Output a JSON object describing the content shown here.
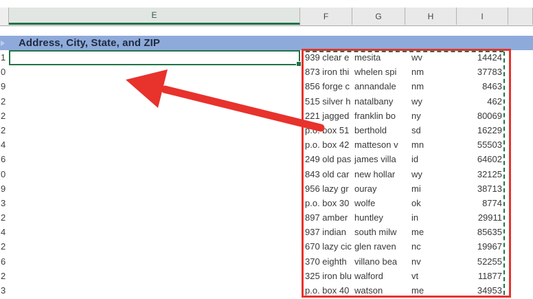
{
  "sheet": {
    "column_headers": [
      "E",
      "F",
      "G",
      "H",
      "I",
      ""
    ],
    "selected_column": "E",
    "banner_title": "Address, City, State, and ZIP",
    "selected_cell_value": ""
  },
  "rows": [
    {
      "digit": "1",
      "address": "939 clear e",
      "city": "mesita",
      "state": "wv",
      "zip": "14424"
    },
    {
      "digit": "0",
      "address": "873 iron thi",
      "city": "whelen spi",
      "state": "nm",
      "zip": "37783"
    },
    {
      "digit": "9",
      "address": "856 forge c",
      "city": "annandale",
      "state": "nm",
      "zip": "8463"
    },
    {
      "digit": "2",
      "address": "515 silver h",
      "city": "natalbany",
      "state": "wy",
      "zip": "462"
    },
    {
      "digit": "2",
      "address": "221 jagged",
      "city": "franklin bo",
      "state": "ny",
      "zip": "80069"
    },
    {
      "digit": "2",
      "address": "p.o. box 51",
      "city": "berthold",
      "state": "sd",
      "zip": "16229"
    },
    {
      "digit": "4",
      "address": "p.o. box 42",
      "city": "matteson v",
      "state": "mn",
      "zip": "55503"
    },
    {
      "digit": "6",
      "address": "249 old pas",
      "city": "james villa",
      "state": "id",
      "zip": "64602"
    },
    {
      "digit": "0",
      "address": "843 old car",
      "city": "new hollar",
      "state": "wy",
      "zip": "32125"
    },
    {
      "digit": "9",
      "address": "956 lazy gr",
      "city": "ouray",
      "state": "mi",
      "zip": "38713"
    },
    {
      "digit": "3",
      "address": "p.o. box 30",
      "city": "wolfe",
      "state": "ok",
      "zip": "8774"
    },
    {
      "digit": "2",
      "address": "897 amber",
      "city": "huntley",
      "state": "in",
      "zip": "29911"
    },
    {
      "digit": "4",
      "address": "937 indian",
      "city": "south milw",
      "state": "me",
      "zip": "85635"
    },
    {
      "digit": "2",
      "address": "670 lazy cic",
      "city": "glen raven",
      "state": "nc",
      "zip": "19967"
    },
    {
      "digit": "6",
      "address": "370 eighth",
      "city": "villano bea",
      "state": "nv",
      "zip": "52255"
    },
    {
      "digit": "2",
      "address": "325 iron blu",
      "city": "walford",
      "state": "vt",
      "zip": "11877"
    },
    {
      "digit": "3",
      "address": "p.o. box 40",
      "city": "watson",
      "state": "me",
      "zip": "34953"
    }
  ],
  "colors": {
    "excel_green": "#217346",
    "marching_ants_green": "#1e7145",
    "banner_blue": "#8eaadb",
    "annotation_red": "#e8322c",
    "header_gray": "#e9e9e9"
  },
  "icons": {
    "fill_handle": "fill-handle-square",
    "arrow": "red-annotation-arrow",
    "banner_marker": "cropped-cell-triangle"
  }
}
